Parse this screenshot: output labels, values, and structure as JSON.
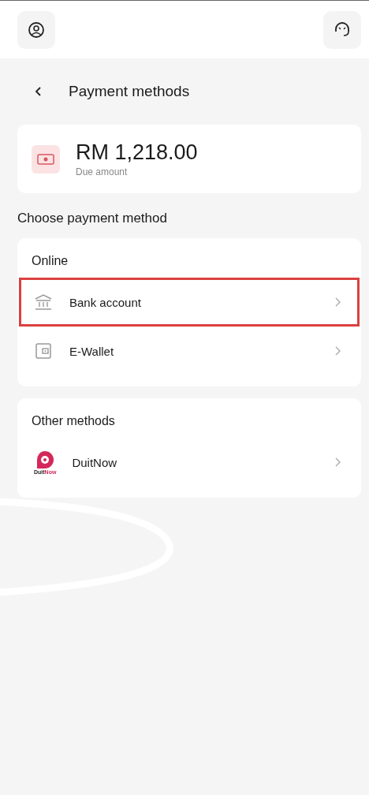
{
  "header": {
    "title": "Payment methods"
  },
  "due": {
    "amount": "RM 1,218.00",
    "label": "Due amount"
  },
  "section_title": "Choose payment method",
  "groups": [
    {
      "title": "Online",
      "methods": [
        {
          "kind": "bank",
          "label": "Bank account",
          "highlighted": true
        },
        {
          "kind": "wallet",
          "label": "E-Wallet",
          "highlighted": false
        }
      ]
    },
    {
      "title": "Other methods",
      "methods": [
        {
          "kind": "duitnow",
          "label": "DuitNow",
          "highlighted": false,
          "logo_dark": "Duit",
          "logo_accent": "Now"
        }
      ]
    }
  ]
}
